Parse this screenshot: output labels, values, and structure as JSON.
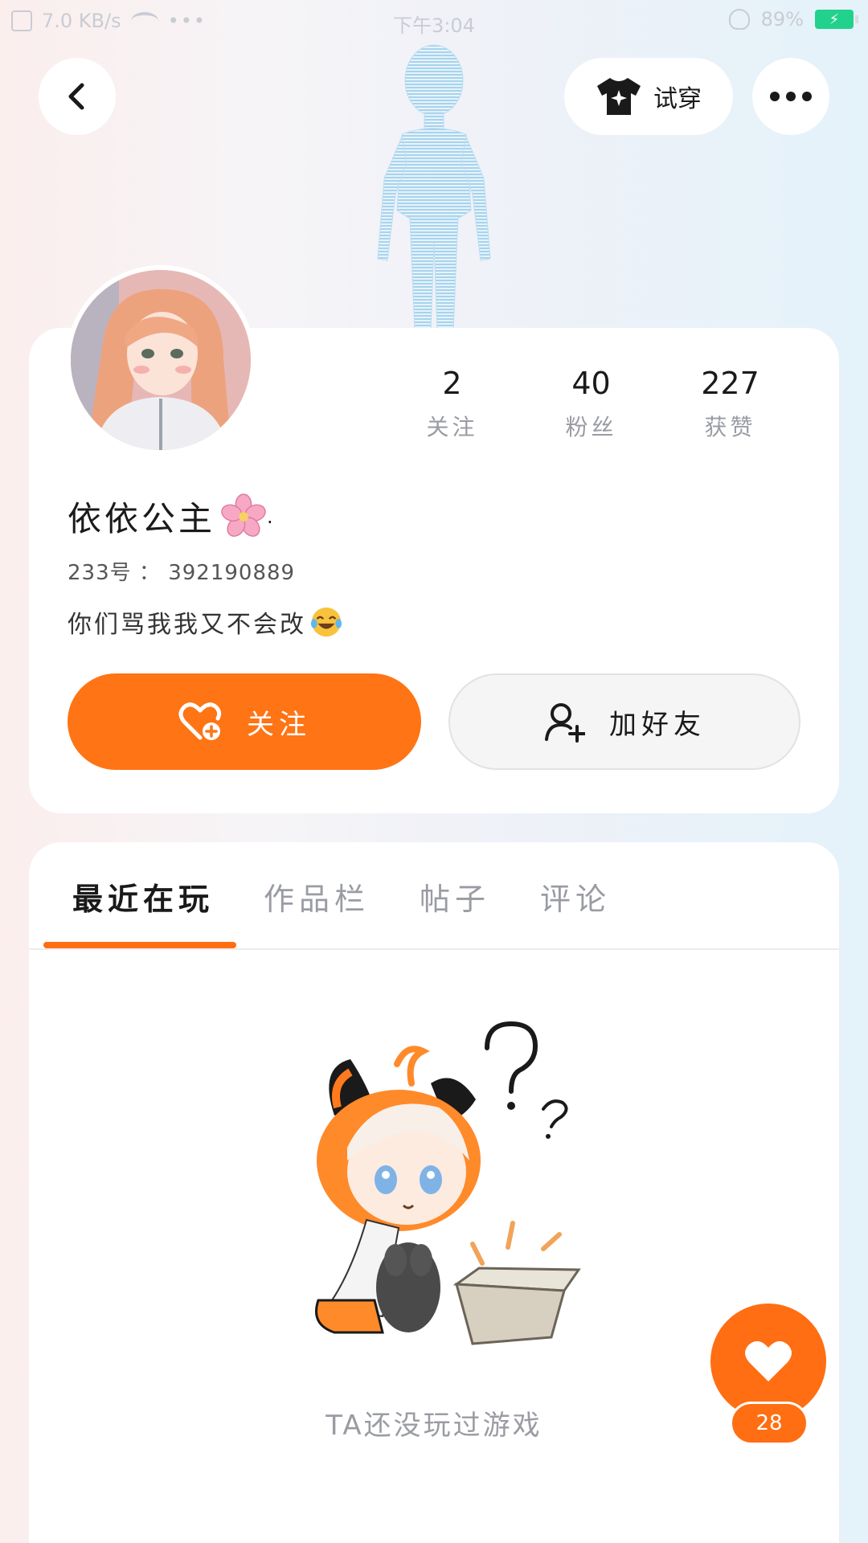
{
  "status_bar": {
    "network_speed": "7.0 KB/s",
    "time": "下午3:04",
    "battery": "89%"
  },
  "header": {
    "try_on_label": "试穿",
    "icons": {
      "back": "chevron-left-icon",
      "try_on": "tshirt-icon",
      "more": "more-horizontal-icon"
    }
  },
  "profile": {
    "nickname": "依依公主",
    "nickname_suffix": ".",
    "id_label": "233号",
    "id_separator": "：",
    "id_value": "392190889",
    "bio": "你们骂我我又不会改",
    "stats": [
      {
        "value": "2",
        "label": "关注"
      },
      {
        "value": "40",
        "label": "粉丝"
      },
      {
        "value": "227",
        "label": "获赞"
      }
    ],
    "follow_label": "关注",
    "add_friend_label": "加好友"
  },
  "tabs": [
    {
      "label": "最近在玩",
      "active": true
    },
    {
      "label": "作品栏",
      "active": false
    },
    {
      "label": "帖子",
      "active": false
    },
    {
      "label": "评论",
      "active": false
    }
  ],
  "empty_state": {
    "text": "TA还没玩过游戏"
  },
  "like_fab": {
    "count": "28"
  },
  "colors": {
    "accent": "#ff7414",
    "battery": "#22d28c",
    "muted_text": "#9a9ca3"
  }
}
